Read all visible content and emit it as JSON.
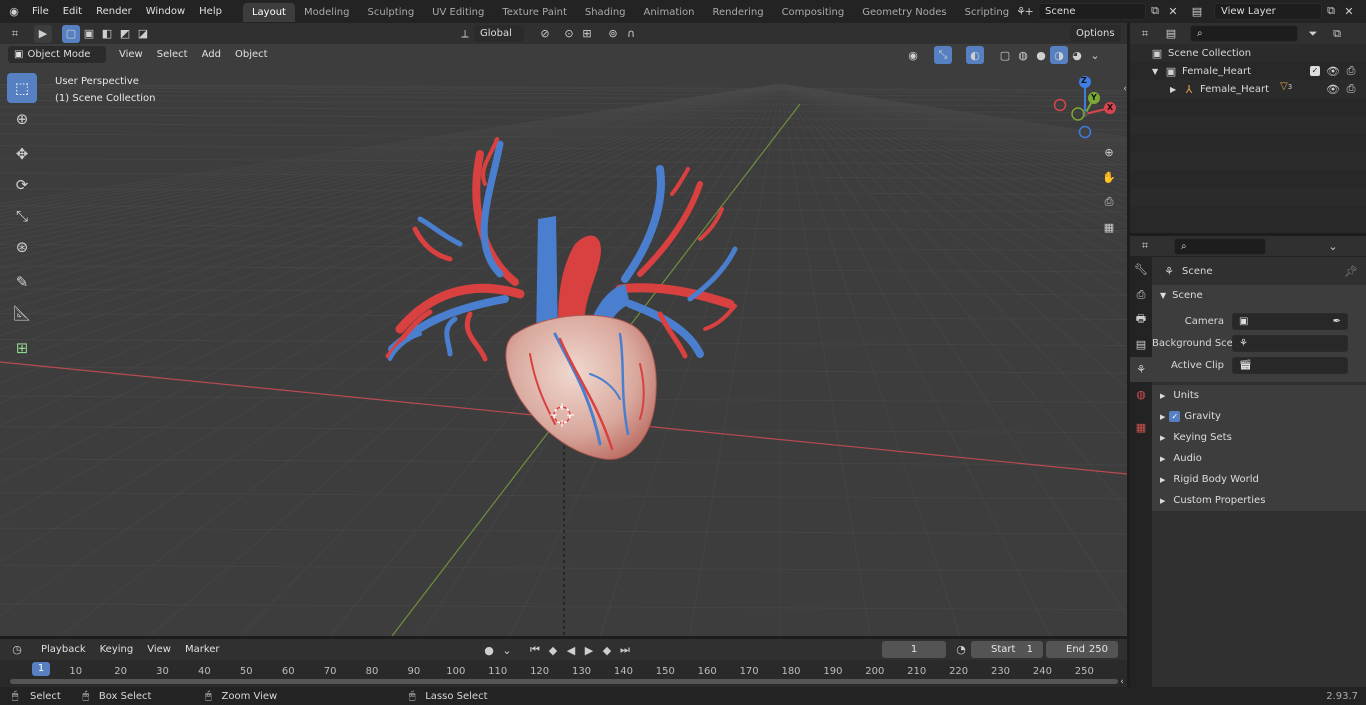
{
  "topbar": {
    "menus": [
      "File",
      "Edit",
      "Render",
      "Window",
      "Help"
    ],
    "workspaces": [
      "Layout",
      "Modeling",
      "Sculpting",
      "UV Editing",
      "Texture Paint",
      "Shading",
      "Animation",
      "Rendering",
      "Compositing",
      "Geometry Nodes",
      "Scripting"
    ],
    "active_workspace": "Layout",
    "scene_name": "Scene",
    "view_layer": "View Layer"
  },
  "viewport_header": {
    "mode": "Object Mode",
    "menus": [
      "View",
      "Select",
      "Add",
      "Object"
    ],
    "orientation": "Global",
    "options_label": "Options"
  },
  "viewport": {
    "perspective_label": "User Perspective",
    "collection_label": "(1) Scene Collection",
    "gizmo_axes": {
      "x": "X",
      "y": "Y",
      "z": "Z"
    }
  },
  "outliner": {
    "root": "Scene Collection",
    "collection": "Female_Heart",
    "object": "Female_Heart",
    "object_badge": "3"
  },
  "properties": {
    "context": "Scene",
    "panel_title": "Scene",
    "fields": [
      {
        "label": "Camera",
        "value": ""
      },
      {
        "label": "Background Scene",
        "value": ""
      },
      {
        "label": "Active Clip",
        "value": ""
      }
    ],
    "sections": [
      "Units",
      "Gravity",
      "Keying Sets",
      "Audio",
      "Rigid Body World",
      "Custom Properties"
    ]
  },
  "timeline": {
    "menus": [
      "Playback",
      "Keying",
      "View",
      "Marker"
    ],
    "current_frame": "1",
    "start_label": "Start",
    "start": "1",
    "end_label": "End",
    "end": "250",
    "ticks": [
      "1",
      "10",
      "20",
      "30",
      "40",
      "50",
      "60",
      "70",
      "80",
      "90",
      "100",
      "110",
      "120",
      "130",
      "140",
      "150",
      "160",
      "170",
      "180",
      "190",
      "200",
      "210",
      "220",
      "230",
      "240",
      "250"
    ]
  },
  "statusbar": {
    "select": "Select",
    "box_select": "Box Select",
    "zoom_view": "Zoom View",
    "lasso_select": "Lasso Select",
    "version": "2.93.7"
  },
  "colors": {
    "accent": "#5680c2",
    "axis_x": "#d9454f",
    "axis_y": "#7ba834",
    "axis_z": "#3d7ee0",
    "artery": "#d94040",
    "vein": "#4a7fd0"
  }
}
